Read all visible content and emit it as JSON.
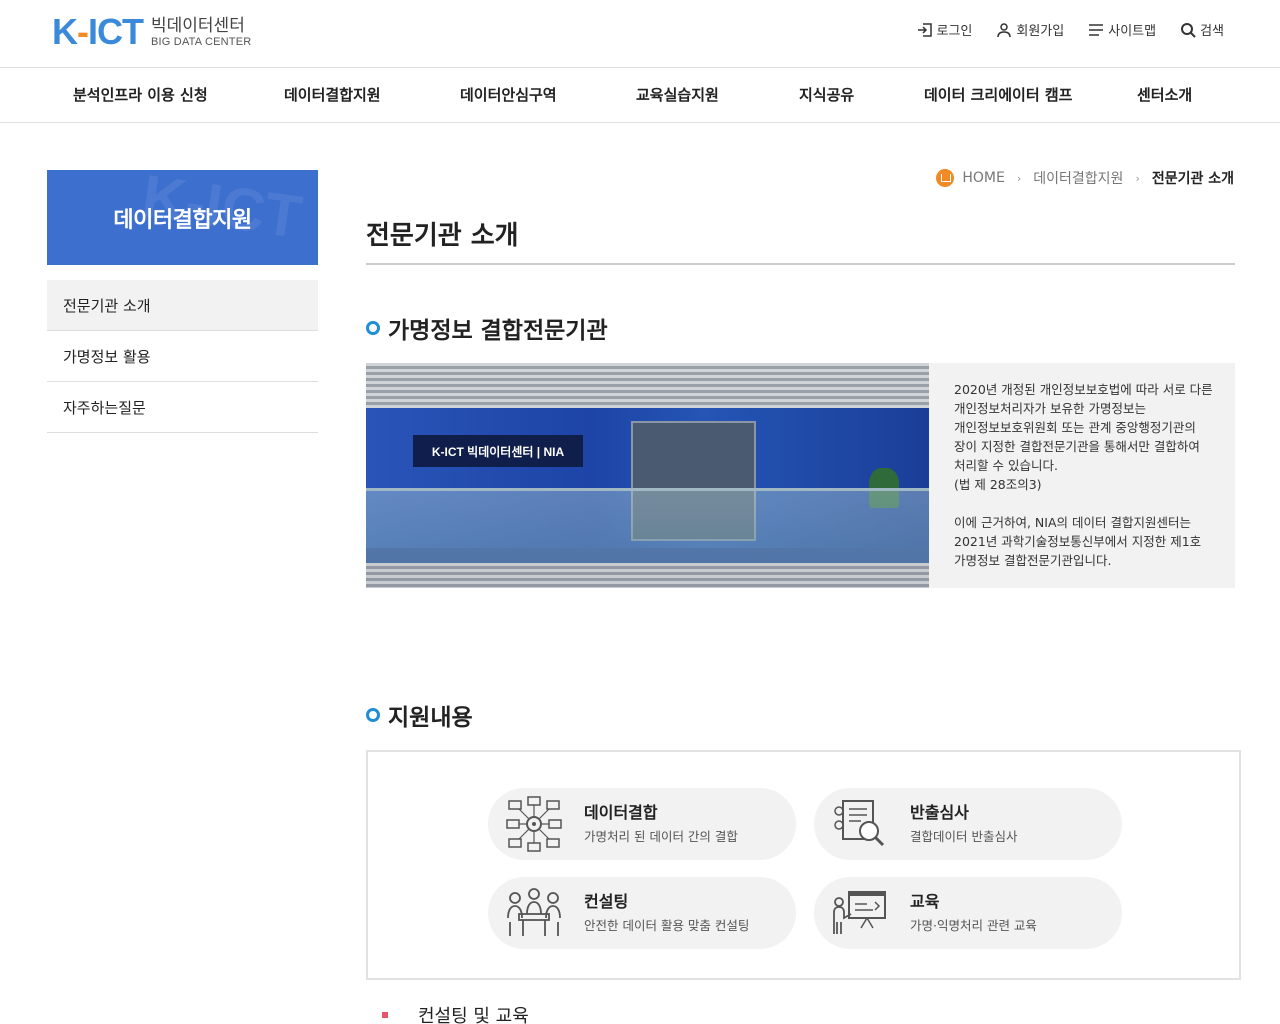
{
  "header": {
    "logo_text": "K-ICT",
    "logo_ko": "빅데이터센터",
    "logo_en": "BIG DATA CENTER",
    "util": {
      "login": "로그인",
      "join": "회원가입",
      "sitemap": "사이트맵",
      "search": "검색"
    }
  },
  "gnb": [
    "분석인프라 이용 신청",
    "데이터결합지원",
    "데이터안심구역",
    "교육실습지원",
    "지식공유",
    "데이터 크리에이터 캠프",
    "센터소개"
  ],
  "sidebar": {
    "title": "데이터결합지원",
    "items": [
      "전문기관 소개",
      "가명정보 활용",
      "자주하는질문"
    ]
  },
  "breadcrumb": {
    "home": "HOME",
    "level1": "데이터결합지원",
    "current": "전문기관 소개"
  },
  "page_title": "전문기관 소개",
  "section1": {
    "title": "가명정보 결합전문기관",
    "photo_sign": "K-ICT 빅데이터센터 | NIA",
    "para1": "2020년 개정된 개인정보보호법에 따라 서로 다른\n개인정보처리자가 보유한 가명정보는\n개인정보보호위원회 또는 관계 중앙행정기관의\n장이 지정한 결합전문기관을 통해서만 결합하여\n처리할 수 있습니다.\n(법 제 28조의3)",
    "para2": "이에 근거하여, NIA의 데이터 결합지원센터는\n2021년 과학기술정보통신부에서 지정한 제1호\n가명정보 결합전문기관입니다."
  },
  "section2": {
    "title": "지원내용",
    "cards": [
      {
        "title": "데이터결합",
        "desc": "가명처리 된 데이터 간의 결합"
      },
      {
        "title": "반출심사",
        "desc": "결합데이터 반출심사"
      },
      {
        "title": "컨설팅",
        "desc": "안전한 데이터 활용 맞춤 컨설팅"
      },
      {
        "title": "교육",
        "desc": "가명·익명처리 관련 교육"
      }
    ]
  },
  "bottom_heading": "컨설팅 및 교육",
  "colors": {
    "accent_blue": "#3d6fcf",
    "logo_blue": "#3b8ad9",
    "logo_orange": "#f08a24",
    "bullet_blue": "#1f8ed6",
    "bullet_pink": "#e8546a"
  }
}
